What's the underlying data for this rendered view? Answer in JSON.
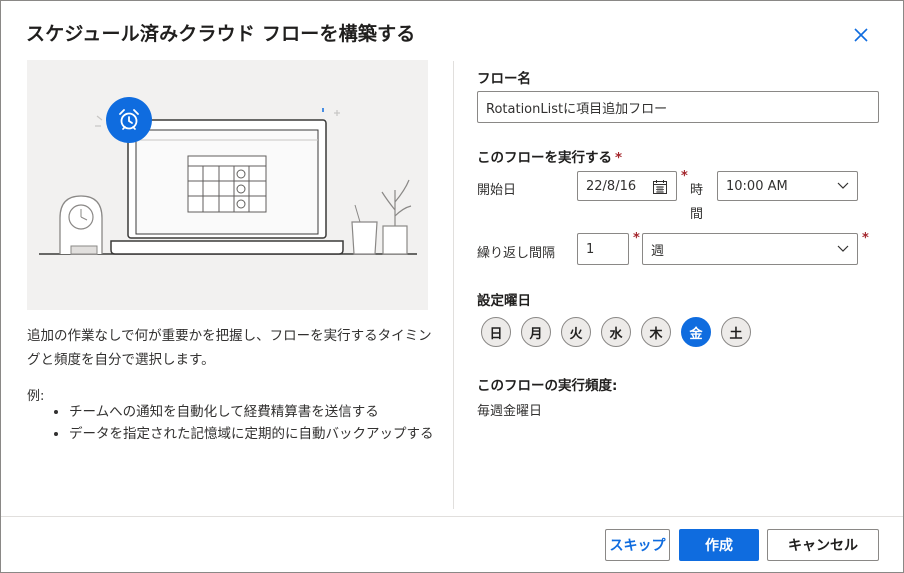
{
  "dialog": {
    "title": "スケジュール済みクラウド フローを構築する",
    "close_icon": "close-icon"
  },
  "left": {
    "description": "追加の作業なしで何が重要かを把握し、フローを実行するタイミングと頻度を自分で選択します。",
    "example_label": "例:",
    "examples": [
      "チームへの通知を自動化して経費精算書を送信する",
      "データを指定された記憶域に定期的に自動バックアップする"
    ],
    "illustration_icon": "alarm-clock-icon"
  },
  "form": {
    "flow_name_label": "フロー名",
    "flow_name_value": "RotationListに項目追加フロー",
    "run_section_label": "このフローを実行する",
    "required_mark": "*",
    "start_date_label": "開始日",
    "start_date_value": "22/8/16",
    "time_label_1": "時",
    "time_label_2": "間",
    "time_value": "10:00 AM",
    "repeat_label": "繰り返し間隔",
    "repeat_count": "1",
    "repeat_unit": "週",
    "weekday_label": "設定曜日",
    "weekdays": [
      "日",
      "月",
      "火",
      "水",
      "木",
      "金",
      "土"
    ],
    "selected_weekday": "金",
    "frequency_label": "このフローの実行頻度:",
    "frequency_value": "毎週金曜日"
  },
  "footer": {
    "skip_label": "スキップ",
    "create_label": "作成",
    "cancel_label": "キャンセル"
  },
  "colors": {
    "accent": "#0f6cdf",
    "required": "#a4262c",
    "border": "#8a8886"
  }
}
